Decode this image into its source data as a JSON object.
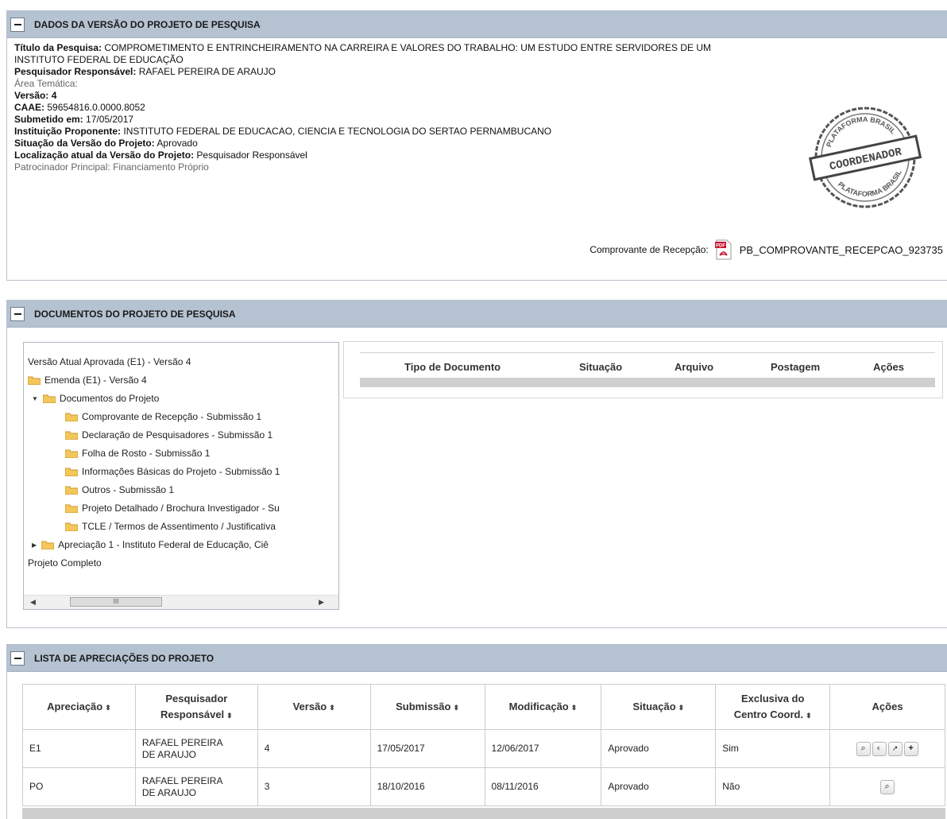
{
  "sections": {
    "dados_title": "DADOS DA VERSÃO DO PROJETO DE PESQUISA",
    "documentos_title": "DOCUMENTOS DO PROJETO DE PESQUISA",
    "lista_title": "LISTA DE APRECIAÇÕES DO PROJETO"
  },
  "dados": {
    "titulo_label": "Título da Pesquisa:",
    "titulo_value_line1": "COMPROMETIMENTO E ENTRINCHEIRAMENTO NA CARREIRA E VALORES DO TRABALHO: UM ESTUDO ENTRE SERVIDORES DE UM",
    "titulo_value_line2": "INSTITUTO FEDERAL DE EDUCAÇÃO",
    "pesquisador_label": "Pesquisador Responsável:",
    "pesquisador_value": "RAFAEL PEREIRA DE ARAUJO",
    "area_label": "Área Temática:",
    "versao_label": "Versão:",
    "versao_value": "4",
    "caae_label": "CAAE:",
    "caae_value": "59654816.0.0000.8052",
    "submetido_label": "Submetido em:",
    "submetido_value": "17/05/2017",
    "instituicao_label": "Instituição Proponente:",
    "instituicao_value": "INSTITUTO FEDERAL DE EDUCACAO, CIENCIA E TECNOLOGIA DO SERTAO PERNAMBUCANO",
    "situacao_label": "Situação da Versão do Projeto:",
    "situacao_value": "Aprovado",
    "localizacao_label": "Localização atual da Versão do Projeto:",
    "localizacao_value": "Pesquisador Responsável",
    "patrocinador_label": "Patrocinador Principal:",
    "patrocinador_value": "Financiamento Próprio",
    "comprovante_label": "Comprovante de Recepção:",
    "comprovante_file": "PB_COMPROVANTE_RECEPCAO_923735",
    "pdf_icon_text": "PDF",
    "stamp": {
      "top": "PLATAFORMA BRASIL",
      "center": "COORDENADOR",
      "bottom": "PLATAFORMA BRASIL"
    }
  },
  "tree": {
    "items": [
      "Versão Atual Aprovada (E1) - Versão 4",
      "Emenda (E1) - Versão 4",
      "Documentos do Projeto",
      "Comprovante de Recepção - Submissão 1",
      "Declaração de Pesquisadores - Submissão 1",
      "Folha de Rosto - Submissão 1",
      "Informações Básicas do Projeto - Submissão 1",
      "Outros - Submissão 1",
      "Projeto Detalhado / Brochura Investigador - Su",
      "TCLE / Termos de Assentimento / Justificativa",
      "Apreciação 1 - Instituto Federal de Educação, Ciê",
      "Projeto Completo"
    ],
    "scroll_thumb": "III"
  },
  "documents_table": {
    "headers": [
      "Tipo de Documento",
      "Situação",
      "Arquivo",
      "Postagem",
      "Ações"
    ]
  },
  "apreciacoes": {
    "headers": {
      "apreciacao": "Apreciação",
      "pesquisador_l1": "Pesquisador",
      "pesquisador_l2": "Responsável",
      "versao": "Versão",
      "submissao": "Submissão",
      "modificacao": "Modificação",
      "situacao": "Situação",
      "exclusiva_l1": "Exclusiva do",
      "exclusiva_l2": "Centro Coord.",
      "acoes": "Ações",
      "sort_glyph": "⬍"
    },
    "rows": [
      {
        "apreciacao": "E1",
        "pesq_l1": "RAFAEL PEREIRA",
        "pesq_l2": "DE ARAUJO",
        "versao": "4",
        "submissao": "17/05/2017",
        "modificacao": "12/06/2017",
        "situacao": "Aprovado",
        "exclusiva": "Sim"
      },
      {
        "apreciacao": "PO",
        "pesq_l1": "RAFAEL PEREIRA",
        "pesq_l2": "DE ARAUJO",
        "versao": "3",
        "submissao": "18/10/2016",
        "modificacao": "08/11/2016",
        "situacao": "Aprovado",
        "exclusiva": "Não"
      }
    ]
  }
}
